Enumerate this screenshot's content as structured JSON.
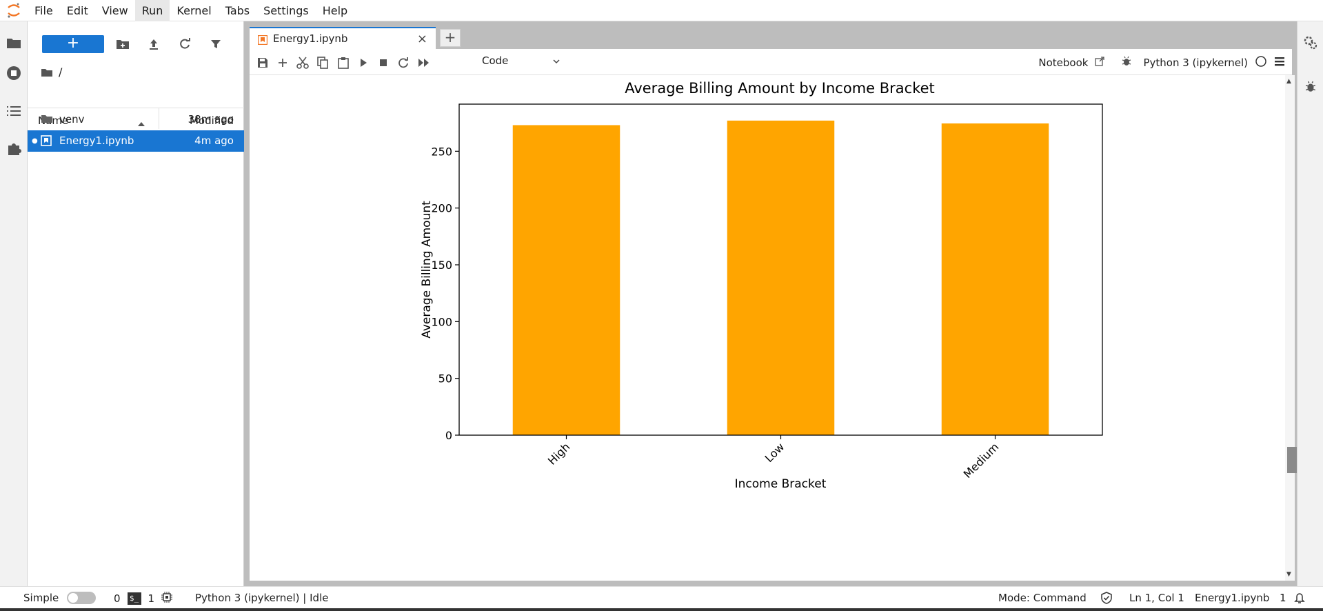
{
  "menubar": {
    "items": [
      "File",
      "Edit",
      "View",
      "Run",
      "Kernel",
      "Tabs",
      "Settings",
      "Help"
    ],
    "active": "Run"
  },
  "filebrowser": {
    "new_label": "+",
    "breadcrumb": "/",
    "columns": {
      "name": "Name",
      "modified": "Modified"
    },
    "rows": [
      {
        "name": "venv",
        "modified": "38m ago",
        "icon": "folder-icon",
        "selected": false
      },
      {
        "name": "Energy1.ipynb",
        "modified": "4m ago",
        "icon": "notebook-icon",
        "selected": true
      }
    ]
  },
  "tab": {
    "title": "Energy1.ipynb",
    "close": "×",
    "add": "+"
  },
  "toolbar": {
    "cell_type": "Code",
    "notebook_label": "Notebook",
    "kernel_label": "Python 3 (ipykernel)"
  },
  "chart_data": {
    "type": "bar",
    "title": "Average Billing Amount by Income Bracket",
    "xlabel": "Income Bracket",
    "ylabel": "Average Billing Amount",
    "categories": [
      "High",
      "Low",
      "Medium"
    ],
    "values": [
      273,
      277,
      274.5
    ],
    "yticks": [
      0,
      50,
      100,
      150,
      200,
      250
    ],
    "ylim": [
      0,
      291.5
    ],
    "color": "#ffa500",
    "grid": false
  },
  "statusbar": {
    "mode_label": "Simple",
    "terminals_count": "0",
    "kernels_count": "1",
    "kernel_status": "Python 3 (ipykernel) | Idle",
    "command_mode": "Mode: Command",
    "cursor_position": "Ln 1, Col 1",
    "filename": "Energy1.ipynb",
    "notifications": "1"
  },
  "colors": {
    "accent": "#1976d2",
    "bar": "#ffa500"
  }
}
